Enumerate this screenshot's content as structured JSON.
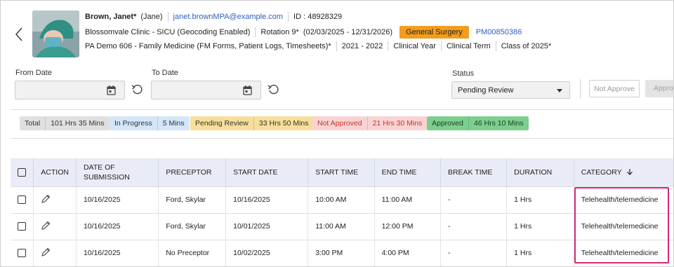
{
  "header": {
    "name": "Brown, Janet*",
    "nickname": "(Jane)",
    "email": "janet.brownMPA@example.com",
    "id_text": "ID : 48928329",
    "clinic": "Blossomvale Clinic - SICU (Geocoding Enabled)",
    "rotation": "Rotation 9*",
    "rotation_dates": "(02/03/2025 - 12/31/2026)",
    "specialty_tag": "General Surgery",
    "specialty_color": "#f39c1e",
    "pm_code": "PM00850386",
    "program": "PA Demo 606 - Family Medicine (FM Forms, Patient Logs, Timesheets)*",
    "years": "2021 - 2022",
    "clinical_year": "Clinical Year",
    "clinical_term": "Clinical Term",
    "class": "Class of 2025*"
  },
  "filters": {
    "from_date_label": "From Date",
    "to_date_label": "To Date",
    "from_date_value": "",
    "to_date_value": "",
    "status_label": "Status",
    "status_value": "Pending Review",
    "not_approve_label": "Not Approve",
    "approve_label": "Approve"
  },
  "summary": [
    {
      "label": "Total",
      "value": "101 Hrs 35 Mins",
      "bg": "#e0e0e0",
      "color": "#333"
    },
    {
      "label": "In Progress",
      "value": "5 Mins",
      "bg": "#d4e6fa",
      "color": "#333"
    },
    {
      "label": "Pending Review",
      "value": "33 Hrs 50 Mins",
      "bg": "#f7df99",
      "color": "#333"
    },
    {
      "label": "Not Approved",
      "value": "21 Hrs 30 Mins",
      "bg": "#f9d3d3",
      "color": "#c0392b"
    },
    {
      "label": "Approved",
      "value": "46 Hrs 10 Mins",
      "bg": "#7ccf8e",
      "color": "#1d3d22"
    }
  ],
  "table": {
    "columns": [
      "ACTION",
      "DATE OF SUBMISSION",
      "PRECEPTOR",
      "START DATE",
      "START TIME",
      "END TIME",
      "BREAK TIME",
      "DURATION",
      "CATEGORY"
    ],
    "rows": [
      {
        "submitted": "10/16/2025",
        "preceptor": "Ford, Skylar",
        "start_date": "10/16/2025",
        "start_time": "10:00 AM",
        "end_time": "11:00 AM",
        "break": "-",
        "duration": "1 Hrs",
        "category": "Telehealth/telemedicine"
      },
      {
        "submitted": "10/16/2025",
        "preceptor": "Ford, Skylar",
        "start_date": "10/01/2025",
        "start_time": "11:00 AM",
        "end_time": "12:00 PM",
        "break": "-",
        "duration": "1 Hrs",
        "category": "Telehealth/telemedicine"
      },
      {
        "submitted": "10/16/2025",
        "preceptor": "No Preceptor",
        "start_date": "10/02/2025",
        "start_time": "3:00 PM",
        "end_time": "4:00 PM",
        "break": "-",
        "duration": "1 Hrs",
        "category": "Telehealth/telemedicine"
      }
    ]
  },
  "icons": {
    "back": "chevron-left-icon",
    "calendar": "calendar-icon",
    "refresh": "refresh-icon",
    "edit": "pencil-icon",
    "sort": "arrow-down-icon"
  },
  "highlight_color": "#d6297a"
}
